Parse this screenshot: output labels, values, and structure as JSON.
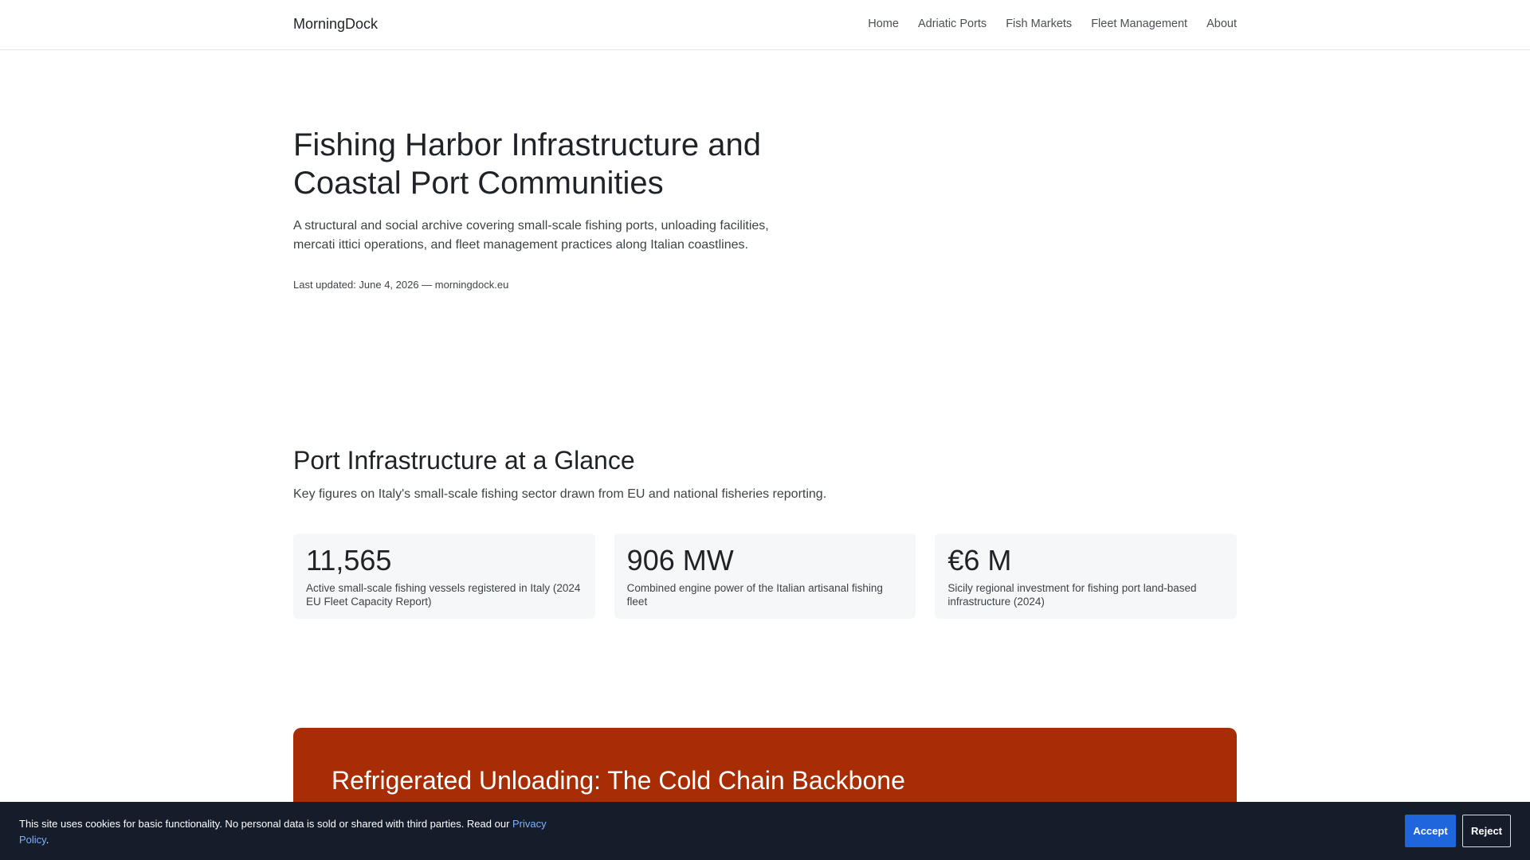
{
  "nav": {
    "brand": "MorningDock",
    "links": [
      "Home",
      "Adriatic Ports",
      "Fish Markets",
      "Fleet Management",
      "About"
    ]
  },
  "hero": {
    "title": "Fishing Harbor Infrastructure and Coastal Port Communities",
    "lead": "A structural and social archive covering small-scale fishing ports, unloading facilities, mercati ittici operations, and fleet management practices along Italian coastlines.",
    "updated": "Last updated: June 4, 2026 — morningdock.eu"
  },
  "glance": {
    "title": "Port Infrastructure at a Glance",
    "subtitle": "Key figures on Italy's small-scale fishing sector drawn from EU and national fisheries reporting.",
    "stats": [
      {
        "value": "11,565",
        "desc": "Active small-scale fishing vessels registered in Italy (2024 EU Fleet Capacity Report)"
      },
      {
        "value": "906 MW",
        "desc": "Combined engine power of the Italian artisanal fishing fleet"
      },
      {
        "value": "€6 M",
        "desc": "Sicily regional investment for fishing port land-based infrastructure (2024)"
      }
    ]
  },
  "feature": {
    "title": "Refrigerated Unloading: The Cold Chain Backbone",
    "color": "#a82d04"
  },
  "cookie": {
    "text": "This site uses cookies for basic functionality. No personal data is sold or shared with third parties. Read our ",
    "link": "Privacy Policy",
    "end": ".",
    "accept": "Accept",
    "reject": "Reject"
  }
}
